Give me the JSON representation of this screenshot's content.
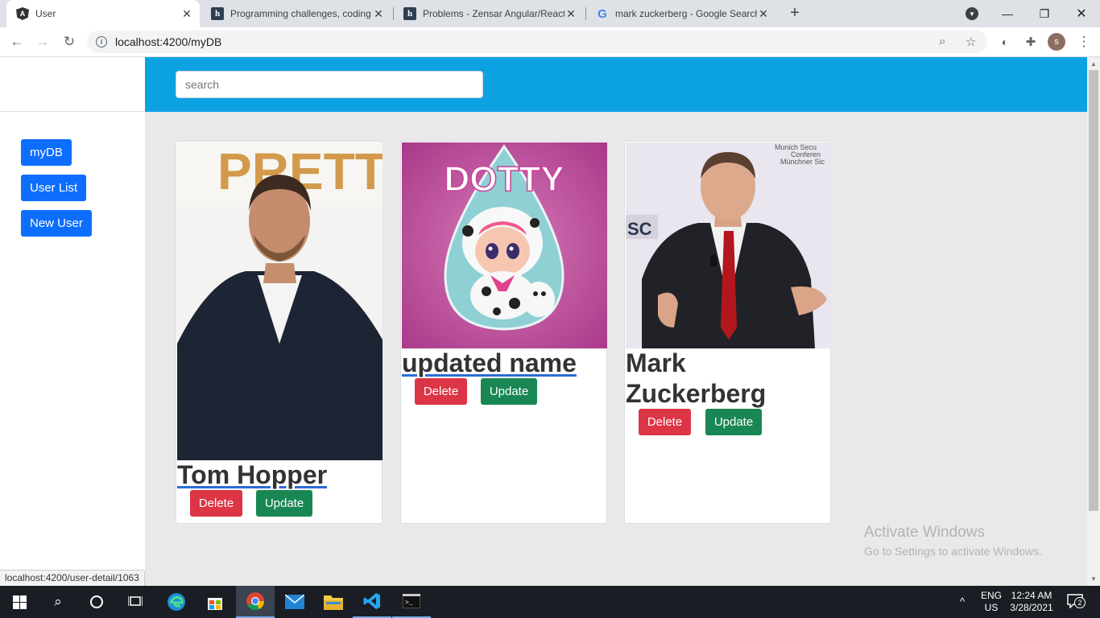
{
  "browser": {
    "tabs": [
      {
        "title": "User",
        "icon": "angular-icon",
        "active": true
      },
      {
        "title": "Programming challenges, coding",
        "icon": "hackerrank-icon",
        "active": false
      },
      {
        "title": "Problems - Zensar Angular/React",
        "icon": "hackerrank-icon",
        "active": false
      },
      {
        "title": "mark zuckerberg - Google Search",
        "icon": "google-icon",
        "active": false
      }
    ],
    "url": "localhost:4200/myDB",
    "profile_initial": "s"
  },
  "app": {
    "search": {
      "placeholder": "search",
      "value": ""
    },
    "sidebar": {
      "items": [
        {
          "label": "myDB"
        },
        {
          "label": "User List"
        },
        {
          "label": "New User"
        }
      ]
    },
    "users": [
      {
        "name": "Tom Hopper",
        "delete_label": "Delete",
        "update_label": "Update",
        "image": "portrait-photo",
        "banner_text": "PRETTY"
      },
      {
        "name": "updated name",
        "delete_label": "Delete",
        "update_label": "Update",
        "image": "cartoon-doll-image",
        "banner_text": "DOTTY"
      },
      {
        "name": "Mark Zuckerberg",
        "delete_label": "Delete",
        "update_label": "Update",
        "image": "portrait-photo",
        "banner_text": "Munich Secu Conferen Münchner Sic"
      }
    ]
  },
  "status_url": "localhost:4200/user-detail/1063",
  "watermark": {
    "line1": "Activate Windows",
    "line2": "Go to Settings to activate Windows."
  },
  "taskbar": {
    "lang": "ENG",
    "region": "US",
    "time": "12:24 AM",
    "date": "3/28/2021",
    "notification_count": "2"
  },
  "colors": {
    "header": "#0ca2e2",
    "primary": "#0d6efd",
    "danger": "#dc3545",
    "success": "#198754"
  }
}
